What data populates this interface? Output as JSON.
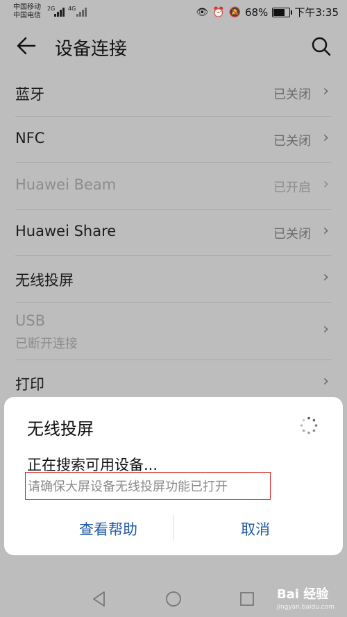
{
  "status_bar": {
    "carrier1": "中国移动",
    "carrier2": "中国电信",
    "net1": "2G",
    "net2": "4G",
    "battery": "68%",
    "time": "下午3:35"
  },
  "header": {
    "title": "设备连接"
  },
  "list": [
    {
      "label": "蓝牙",
      "value": "已关闭"
    },
    {
      "label": "NFC",
      "value": "已关闭"
    },
    {
      "label": "Huawei Beam",
      "value": "已开启"
    },
    {
      "label": "Huawei Share",
      "value": "已关闭"
    },
    {
      "label": "无线投屏"
    },
    {
      "label": "USB",
      "sub": "已断开连接"
    },
    {
      "label": "打印"
    }
  ],
  "dialog": {
    "title": "无线投屏",
    "message": "正在搜索可用设备...",
    "hint": "请确保大屏设备无线投屏功能已打开",
    "help_button": "查看帮助",
    "cancel_button": "取消"
  },
  "watermark": {
    "brand": "Bai 经验",
    "url": "jingyan.baidu.com"
  },
  "colors": {
    "accent": "#1f5aa6",
    "highlight_border": "#d81e1e",
    "background_dim": "#bdbdbd"
  }
}
